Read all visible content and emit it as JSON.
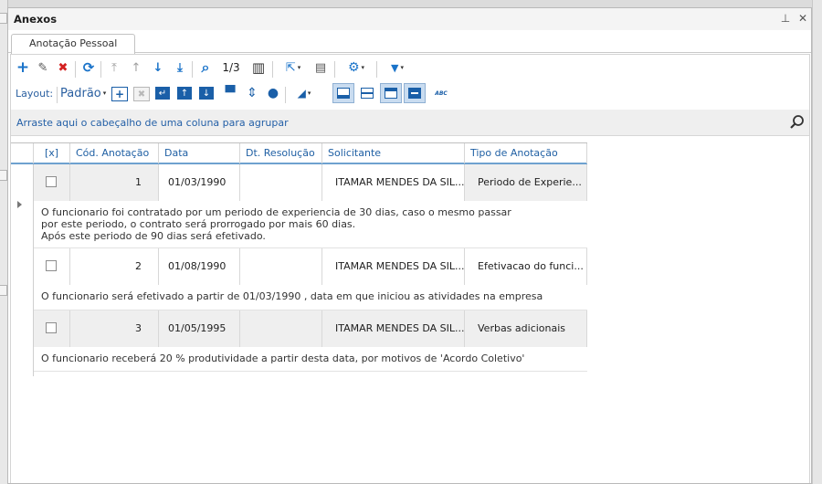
{
  "panel": {
    "title": "Anexos",
    "pin_glyph": "⊥",
    "close_glyph": "✕"
  },
  "tab": {
    "label": "Anotação Pessoal"
  },
  "toolbar": {
    "record_position": "1/3",
    "layout_label": "Layout:",
    "layout_value": "Padrão",
    "icons": {
      "add": "+",
      "edit": "✎",
      "delete": "✖",
      "refresh": "⟳",
      "first": "⤒",
      "prev": "↑",
      "next": "↓",
      "last": "⤓",
      "search": "⌕",
      "columns": "▥",
      "export": "⇱",
      "report": "▤",
      "settings": "⚙",
      "filter": "▼",
      "chevron": "▾",
      "abc": "ABC"
    }
  },
  "group_panel": {
    "hint": "Arraste aqui o cabeçalho de uma coluna para agrupar"
  },
  "grid": {
    "columns": {
      "select": "[x]",
      "code": "Cód. Anotação",
      "date": "Data",
      "resolution_date": "Dt. Resolução",
      "requester": "Solicitante",
      "type": "Tipo de Anotação"
    },
    "rows": [
      {
        "code": "1",
        "date": "01/03/1990",
        "resolution_date": "",
        "requester": "ITAMAR MENDES DA SIL...",
        "type": "Periodo de Experie...",
        "note_lines": [
          "O funcionario foi contratado por um periodo de experiencia de 30 dias, caso o mesmo passar",
          "por este periodo, o contrato será prorrogado por mais 60 dias.",
          "Após este periodo de 90 dias será efetivado."
        ]
      },
      {
        "code": "2",
        "date": "01/08/1990",
        "resolution_date": "",
        "requester": "ITAMAR MENDES DA SIL...",
        "type": "Efetivacao do funci...",
        "note_lines": [
          "O funcionario será efetivado a partir de 01/03/1990 , data em que iniciou as atividades na empresa"
        ]
      },
      {
        "code": "3",
        "date": "01/05/1995",
        "resolution_date": "",
        "requester": "ITAMAR MENDES DA SIL...",
        "type": "Verbas adicionais",
        "note_lines": [
          "O funcionario receberá 20 % produtividade a partir desta data, por motivos de 'Acordo Coletivo'"
        ]
      }
    ]
  },
  "colors": {
    "accent": "#2060a4",
    "header_line": "#6ea1cf",
    "row_shade": "#efefef",
    "delete_red": "#d42020",
    "add_blue": "#1a73c9"
  }
}
